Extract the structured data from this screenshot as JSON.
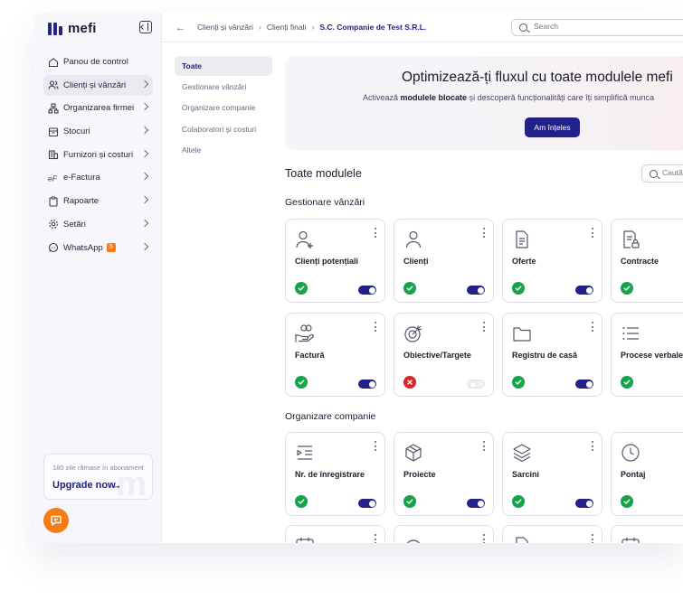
{
  "app": {
    "name": "mefi"
  },
  "sidebar": {
    "items": [
      {
        "label": "Panou de control",
        "icon": "home-icon",
        "chevron": false,
        "active": false
      },
      {
        "label": "Clienți și vânzări",
        "icon": "users-icon",
        "chevron": true,
        "active": true
      },
      {
        "label": "Organizarea firmei",
        "icon": "org-chart-icon",
        "chevron": true,
        "active": false
      },
      {
        "label": "Stocuri",
        "icon": "inbox-icon",
        "chevron": true,
        "active": false
      },
      {
        "label": "Furnizori și costuri",
        "icon": "building-icon",
        "chevron": true,
        "active": false
      },
      {
        "label": "e-Factura",
        "icon": "e-factura-icon",
        "chevron": true,
        "active": false
      },
      {
        "label": "Rapoarte",
        "icon": "clipboard-icon",
        "chevron": true,
        "active": false
      },
      {
        "label": "Setări",
        "icon": "gear-icon",
        "chevron": true,
        "active": false
      },
      {
        "label": "WhatsApp",
        "icon": "whatsapp-icon",
        "chevron": true,
        "active": false,
        "badge": "5"
      }
    ],
    "upgrade": {
      "days_text": "180 zile rămase în abonament",
      "label": "Upgrade now",
      "arrow": "→",
      "watermark": "m"
    }
  },
  "topbar": {
    "breadcrumb": [
      "Clienți și vânzări",
      "Clienți finali",
      "S.C. Companie de Test S.R.L."
    ],
    "search_placeholder": "Search"
  },
  "categories": [
    {
      "label": "Toate",
      "active": true
    },
    {
      "label": "Gestionare vânzări",
      "active": false
    },
    {
      "label": "Organizare companie",
      "active": false
    },
    {
      "label": "Colaboratori și costuri",
      "active": false
    },
    {
      "label": "Altele",
      "active": false
    }
  ],
  "banner": {
    "title": "Optimizează-ți fluxul cu toate modulele mefi",
    "subtitle_before": "Activează ",
    "subtitle_bold": "modulele blocate",
    "subtitle_after": " și descoperă funcționalități care îți simplifică munca",
    "button": "Am înțeles"
  },
  "modules_title": "Toate modulele",
  "modules_search_placeholder": "Caută",
  "sections": [
    {
      "title": "Gestionare vânzări",
      "cards": [
        {
          "name": "Clienți potențiali",
          "icon": "user-plus-icon",
          "status": "active",
          "toggle": true
        },
        {
          "name": "Clienți",
          "icon": "user-icon",
          "status": "active",
          "toggle": true
        },
        {
          "name": "Oferte",
          "icon": "document-icon",
          "status": "active",
          "toggle": true
        },
        {
          "name": "Contracte",
          "icon": "contract-lock-icon",
          "status": "active",
          "toggle": true
        },
        {
          "name": "Factură",
          "icon": "hand-coins-icon",
          "status": "active",
          "toggle": true
        },
        {
          "name": "Obiective/Targete",
          "icon": "target-icon",
          "status": "inactive",
          "toggle": false
        },
        {
          "name": "Registru de casă",
          "icon": "folder-icon",
          "status": "active",
          "toggle": true
        },
        {
          "name": "Procese verbale",
          "icon": "list-icon",
          "status": "active",
          "toggle": true
        }
      ]
    },
    {
      "title": "Organizare companie",
      "cards": [
        {
          "name": "Nr. de înregistrare",
          "icon": "list-indent-icon",
          "status": "active",
          "toggle": true
        },
        {
          "name": "Proiecte",
          "icon": "box-icon",
          "status": "active",
          "toggle": true
        },
        {
          "name": "Sarcini",
          "icon": "layers-icon",
          "status": "active",
          "toggle": true
        },
        {
          "name": "Pontaj",
          "icon": "clock-icon",
          "status": "active",
          "toggle": true
        }
      ]
    }
  ],
  "partial_row_icons": [
    "calendar-icon",
    "circle-icon",
    "document-icon",
    "calendar-icon"
  ],
  "colors": {
    "brand": "#22218a",
    "accent": "#f47d16",
    "success": "#16a34a",
    "danger": "#dc2626"
  }
}
